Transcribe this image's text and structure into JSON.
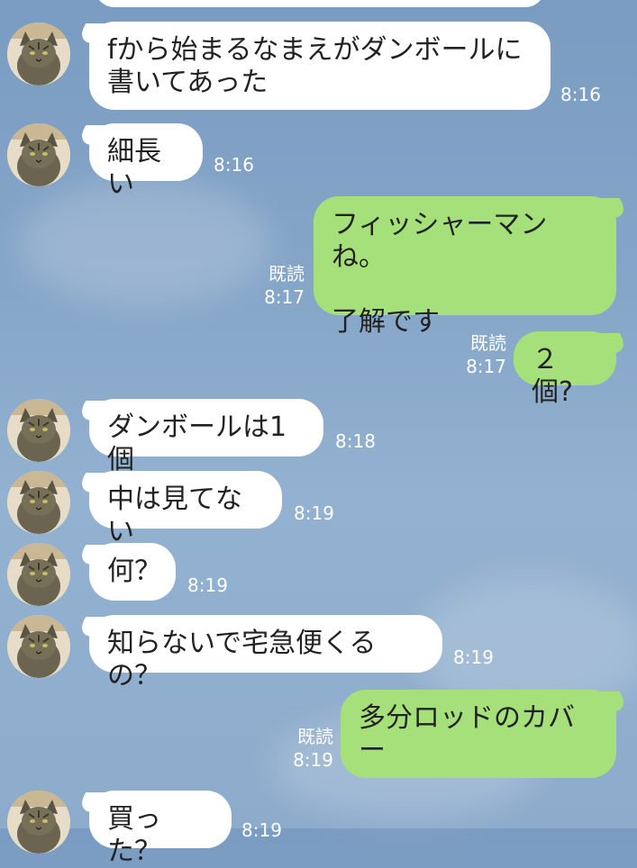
{
  "chat": {
    "messages": [
      {
        "side": "in",
        "text": "fから始まるなまえがダンボールに\n書いてあった",
        "time": "8:16"
      },
      {
        "side": "in",
        "text": "細長い",
        "time": "8:16"
      },
      {
        "side": "out",
        "text": "フィッシャーマンね。\n\n了解です",
        "read": "既読",
        "time": "8:17"
      },
      {
        "side": "out",
        "text": "２個?",
        "read": "既読",
        "time": "8:17"
      },
      {
        "side": "in",
        "text": "ダンボールは1個",
        "time": "8:18"
      },
      {
        "side": "in",
        "text": "中は見てない",
        "time": "8:19"
      },
      {
        "side": "in",
        "text": "何？",
        "time": "8:19"
      },
      {
        "side": "in",
        "text": "知らないで宅急便くるの？",
        "time": "8:19"
      },
      {
        "side": "out",
        "text": "多分ロッドのカバー",
        "read": "既読",
        "time": "8:19"
      },
      {
        "side": "in",
        "text": "買った？",
        "time": "8:19"
      }
    ]
  },
  "colors": {
    "incoming": "#ffffff",
    "outgoing": "#a6e07a",
    "background": "#86a6c8"
  },
  "icons": {
    "avatar": "cat-avatar-icon"
  }
}
